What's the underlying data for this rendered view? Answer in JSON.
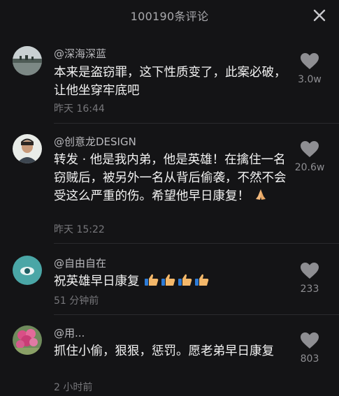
{
  "header": {
    "title": "100190条评论",
    "close_icon": "close-icon"
  },
  "comments": [
    {
      "username": "@深海深蓝",
      "text": "本来是盗窃罪，这下性质变了，此案必破，让他坐穿牢底吧",
      "time": "昨天 16:44",
      "likes": "3.0w",
      "avatar": "landscape-avatar"
    },
    {
      "username": "@创意龙DESIGN",
      "text": "转发 · 他是我内弟，他是英雄！在擒住一名窃贼后，被另外一名从背后偷袭，不然不会受这么严重的伤。希望他早日康复！",
      "emoji": "praying-hands-emoji",
      "time": "昨天 15:22",
      "likes": "20.6w",
      "avatar": "portrait-avatar"
    },
    {
      "username": "@自由自在",
      "text": "祝英雄早日康复",
      "emoji": "thumbs-up-emoji x4",
      "time": "51 分钟前",
      "likes": "233",
      "avatar": "teal-eye-avatar"
    },
    {
      "username": "@用...",
      "text": "抓住小偷，狠狠，惩罚。愿老弟早日康复",
      "time": "2 小时前",
      "likes": "803",
      "avatar": "pink-flower-avatar"
    }
  ],
  "colors": {
    "background": "#141416",
    "username": "#b8b8bc",
    "text": "#f2f2f2",
    "meta": "#77777b",
    "heart": "#8e8e92"
  }
}
